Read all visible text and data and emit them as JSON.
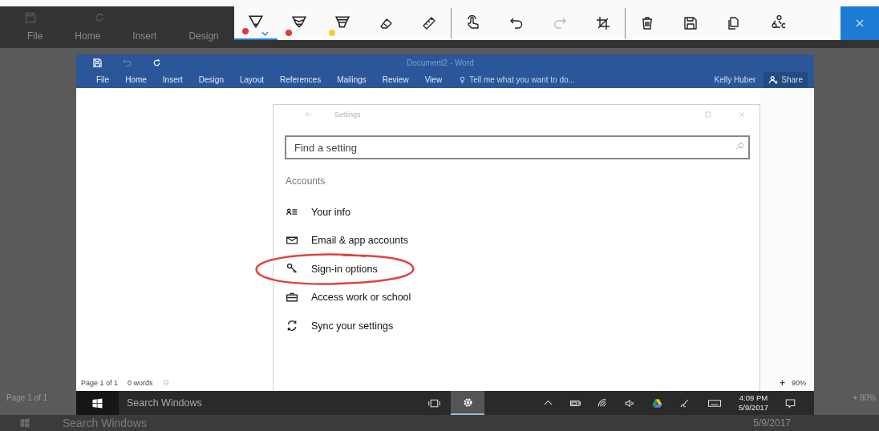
{
  "background_app": {
    "ribbon_tabs": [
      "File",
      "Home",
      "Insert",
      "Design"
    ],
    "status": "Page 1 of 1",
    "zoom": "+ 90%",
    "taskbar_search": "Search Windows",
    "date": "5/9/2017"
  },
  "sketch_toolbar": {
    "pens": [
      {
        "color": "#e53935",
        "selected": true
      },
      {
        "color": "#e53935",
        "selected": false
      },
      {
        "color": "#f2d230",
        "selected": false
      }
    ],
    "tools": [
      {
        "disabled": false
      },
      {
        "disabled": false
      },
      {
        "disabled": false
      },
      {
        "disabled": false
      },
      {
        "disabled": true
      },
      {
        "disabled": false
      },
      {
        "disabled": false
      },
      {
        "disabled": false
      },
      {
        "disabled": false
      },
      {
        "disabled": false
      }
    ]
  },
  "word": {
    "title": "Document2 - Word",
    "tabs": [
      "File",
      "Home",
      "Insert",
      "Design",
      "Layout",
      "References",
      "Mailings",
      "Review",
      "View"
    ],
    "tell_me": "Tell me what you want to do...",
    "user": "Kelly Huber",
    "share": "Share",
    "status": {
      "page": "Page 1 of 1",
      "words": "0 words",
      "zoom_in": "+",
      "zoom": "90%"
    }
  },
  "settings": {
    "title": "Settings",
    "search": {
      "placeholder": "Find a setting"
    },
    "section": "Accounts",
    "items": [
      {
        "label": "Your info",
        "circled": false
      },
      {
        "label": "Email & app accounts",
        "circled": false
      },
      {
        "label": "Sign-in options",
        "circled": true
      },
      {
        "label": "Access work or school",
        "circled": false
      },
      {
        "label": "Sync your settings",
        "circled": false
      }
    ]
  },
  "taskbar": {
    "search": "Search Windows",
    "buttons": [
      {
        "active": false
      },
      {
        "active": true
      }
    ],
    "time": "4:09 PM",
    "date": "5/9/2017"
  }
}
